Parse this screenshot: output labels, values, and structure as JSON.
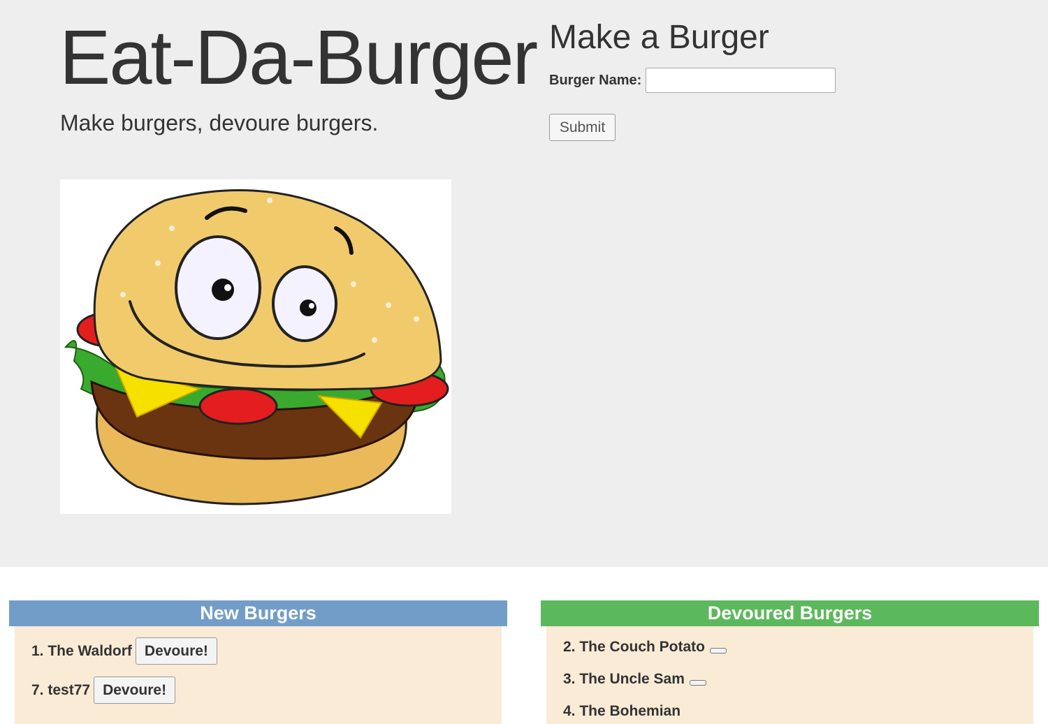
{
  "header": {
    "title": "Eat-Da-Burger",
    "tagline": "Make burgers, devoure burgers."
  },
  "hero_image": {
    "icon": "cartoon-burger-icon"
  },
  "form": {
    "title": "Make a Burger",
    "label": "Burger Name:",
    "input_value": "",
    "submit_label": "Submit"
  },
  "new_burgers": {
    "heading": "New Burgers",
    "header_color": "#729dc8",
    "button_label": "Devoure!",
    "items": [
      {
        "label": "1. The Waldorf"
      },
      {
        "label": "7. test77"
      }
    ]
  },
  "devoured_burgers": {
    "heading": "Devoured Burgers",
    "header_color": "#5cb85c",
    "items": [
      {
        "label": "2. The Couch Potato"
      },
      {
        "label": "3. The Uncle Sam"
      },
      {
        "label": "4. The Bohemian"
      }
    ]
  },
  "colors": {
    "jumbotron_bg": "#eeeeee",
    "list_bg": "#faebd7"
  }
}
